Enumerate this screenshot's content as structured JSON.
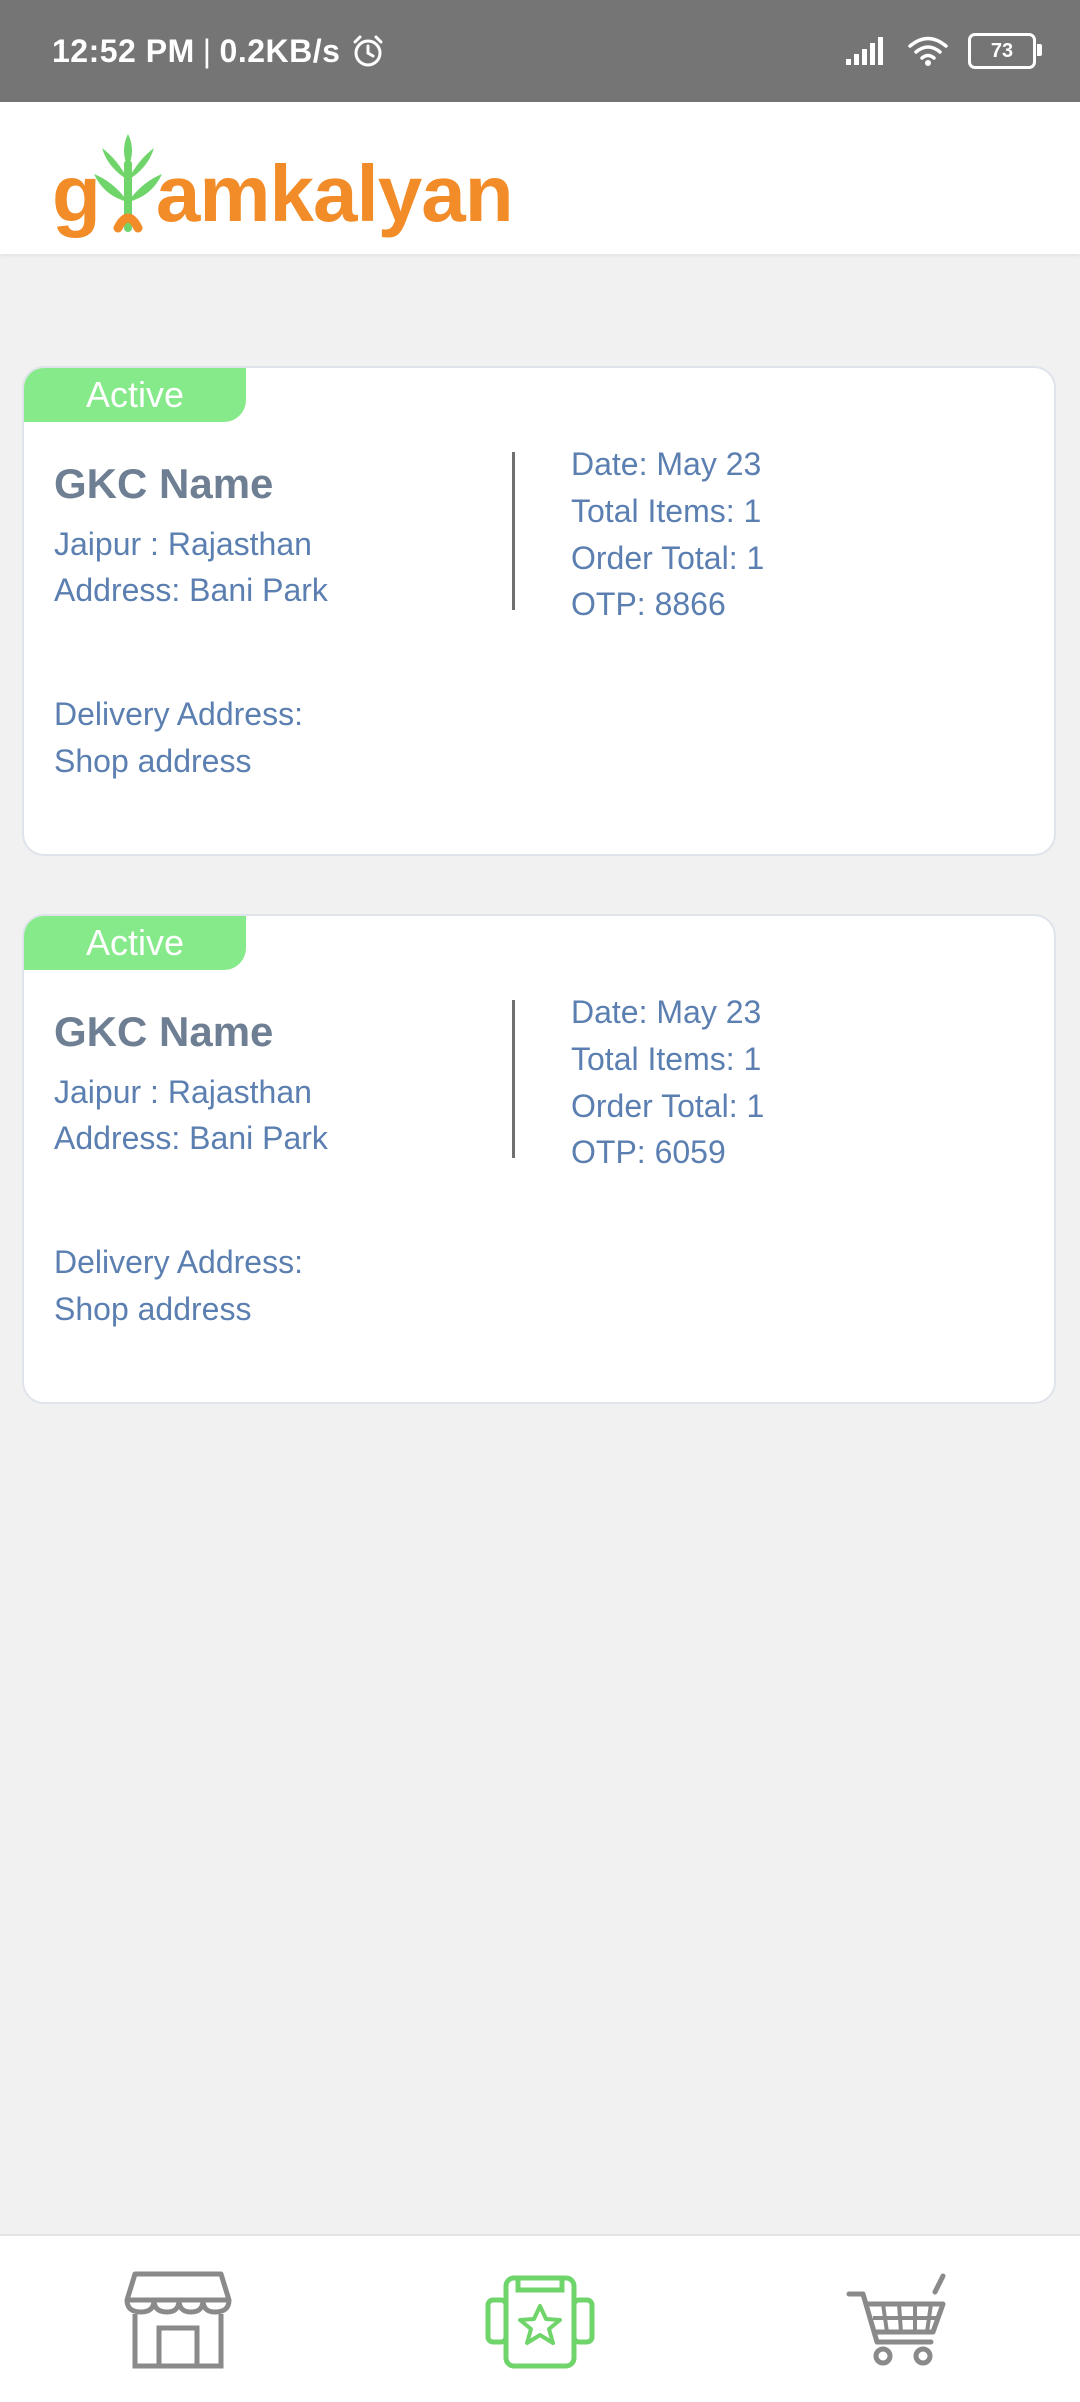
{
  "status_bar": {
    "time": "12:52 PM",
    "separator": "|",
    "speed": "0.2KB/s",
    "battery": "73",
    "icons": [
      "alarm-icon",
      "signal-icon",
      "wifi-icon",
      "battery-icon"
    ]
  },
  "header": {
    "logo_g": "g",
    "logo_rest": "amkalyan",
    "logo_alt": "gramkalyan"
  },
  "orders": [
    {
      "status": "Active",
      "shop_name": "GKC Name",
      "location": "Jaipur : Rajasthan",
      "address": "Address: Bani Park",
      "delivery_label": "Delivery Address:",
      "delivery_value": "Shop address",
      "date": "Date: May 23",
      "total_items": "Total Items: 1",
      "order_total": "Order Total: 1",
      "otp": "OTP: 8866"
    },
    {
      "status": "Active",
      "shop_name": "GKC Name",
      "location": "Jaipur : Rajasthan",
      "address": "Address: Bani Park",
      "delivery_label": "Delivery Address:",
      "delivery_value": "Shop address",
      "date": "Date: May 23",
      "total_items": "Total Items: 1",
      "order_total": "Order Total: 1",
      "otp": "OTP: 6059"
    }
  ],
  "bottom_nav": [
    {
      "icon": "store-icon",
      "active": false
    },
    {
      "icon": "orders-star-icon",
      "active": true
    },
    {
      "icon": "cart-icon",
      "active": false
    }
  ],
  "colors": {
    "brand_orange": "#f28c28",
    "brand_green": "#6fd46a",
    "badge_green": "#86ea8a",
    "text_blue": "#5b7fb0",
    "title_gray": "#6f7f93",
    "nav_gray": "#8a8a8a"
  }
}
